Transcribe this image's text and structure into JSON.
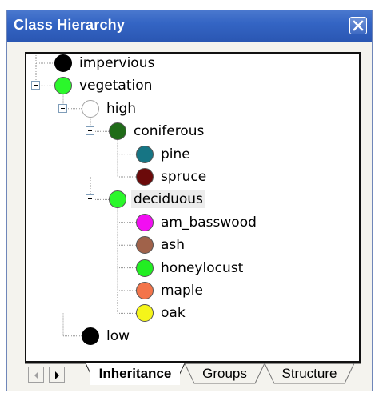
{
  "window": {
    "title": "Class Hierarchy"
  },
  "tree": [
    {
      "id": "impervious",
      "label": "impervious",
      "color": "#000000",
      "depth": 0,
      "expandable": false,
      "hollow": false
    },
    {
      "id": "vegetation",
      "label": "vegetation",
      "color": "#2bf72b",
      "depth": 0,
      "expandable": true,
      "hollow": false
    },
    {
      "id": "high",
      "label": "high",
      "color": "#ffffff",
      "depth": 1,
      "expandable": true,
      "hollow": true
    },
    {
      "id": "coniferous",
      "label": "coniferous",
      "color": "#1f6b18",
      "depth": 2,
      "expandable": true,
      "hollow": false
    },
    {
      "id": "pine",
      "label": "pine",
      "color": "#167584",
      "depth": 3,
      "expandable": false,
      "hollow": false
    },
    {
      "id": "spruce",
      "label": "spruce",
      "color": "#6b0a0a",
      "depth": 3,
      "expandable": false,
      "hollow": false
    },
    {
      "id": "deciduous",
      "label": "deciduous",
      "color": "#2bf72b",
      "depth": 2,
      "expandable": true,
      "hollow": false,
      "selected": true
    },
    {
      "id": "am_basswood",
      "label": "am_basswood",
      "color": "#f20ef2",
      "depth": 3,
      "expandable": false,
      "hollow": false
    },
    {
      "id": "ash",
      "label": "ash",
      "color": "#a0624a",
      "depth": 3,
      "expandable": false,
      "hollow": false
    },
    {
      "id": "honeylocust",
      "label": "honeylocust",
      "color": "#22ee22",
      "depth": 3,
      "expandable": false,
      "hollow": false
    },
    {
      "id": "maple",
      "label": "maple",
      "color": "#f3744a",
      "depth": 3,
      "expandable": false,
      "hollow": false
    },
    {
      "id": "oak",
      "label": "oak",
      "color": "#f5f51a",
      "depth": 3,
      "expandable": false,
      "hollow": false
    },
    {
      "id": "low",
      "label": "low",
      "color": "#000000",
      "depth": 1,
      "expandable": false,
      "hollow": false
    }
  ],
  "tabs": [
    {
      "label": "Inheritance",
      "active": true
    },
    {
      "label": "Groups",
      "active": false
    },
    {
      "label": "Structure",
      "active": false
    }
  ],
  "icons": {
    "close": "close-icon",
    "scroll_left": "arrow-left-icon",
    "scroll_right": "arrow-right-icon",
    "expander": "minus-box-icon"
  }
}
